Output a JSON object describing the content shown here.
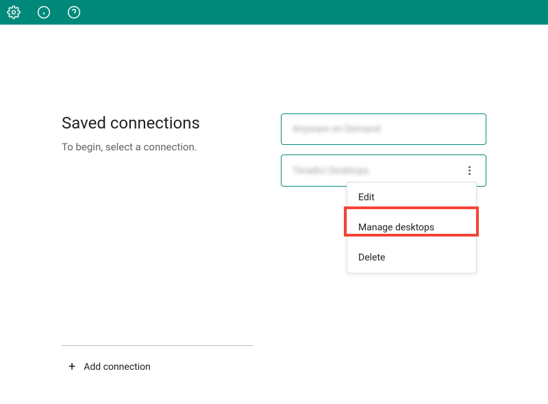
{
  "toolbar": {
    "icons": {
      "settings": "gear-icon",
      "info": "info-icon",
      "help": "help-icon"
    }
  },
  "main": {
    "title": "Saved connections",
    "subtitle": "To begin, select a connection."
  },
  "connections": [
    {
      "label": "Anyware on Demand",
      "blurred": true
    },
    {
      "label": "Teradici Desktops",
      "blurred": true
    }
  ],
  "context_menu": {
    "items": [
      {
        "label": "Edit"
      },
      {
        "label": "Manage desktops",
        "highlighted": true
      },
      {
        "label": "Delete"
      }
    ]
  },
  "footer": {
    "add_connection": "Add connection"
  },
  "colors": {
    "accent": "#00897b",
    "highlight": "#f44336"
  }
}
